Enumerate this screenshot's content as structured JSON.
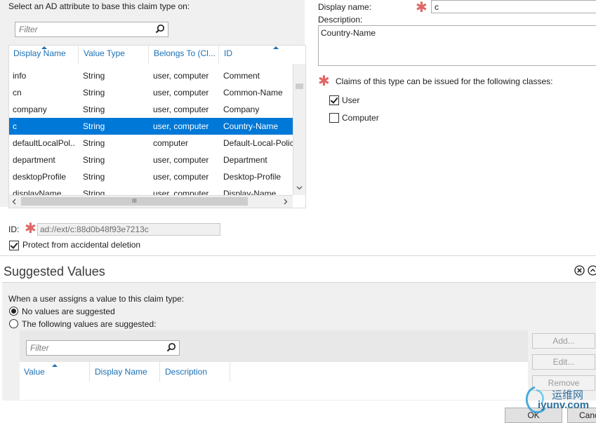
{
  "attribute_section": {
    "heading": "Select an AD attribute to base this claim type on:",
    "filter_placeholder": "Filter",
    "columns": [
      "Display Name",
      "Value Type",
      "Belongs To (Cl...",
      "ID"
    ],
    "rows": [
      {
        "display_name": "info",
        "value_type": "String",
        "belongs_to": "user, computer",
        "id": "Comment"
      },
      {
        "display_name": "cn",
        "value_type": "String",
        "belongs_to": "user, computer",
        "id": "Common-Name"
      },
      {
        "display_name": "company",
        "value_type": "String",
        "belongs_to": "user, computer",
        "id": "Company"
      },
      {
        "display_name": "c",
        "value_type": "String",
        "belongs_to": "user, computer",
        "id": "Country-Name",
        "selected": true
      },
      {
        "display_name": "defaultLocalPol...",
        "value_type": "String",
        "belongs_to": "computer",
        "id": "Default-Local-Polic"
      },
      {
        "display_name": "department",
        "value_type": "String",
        "belongs_to": "user, computer",
        "id": "Department"
      },
      {
        "display_name": "desktopProfile",
        "value_type": "String",
        "belongs_to": "user, computer",
        "id": "Desktop-Profile"
      },
      {
        "display_name": "displayName",
        "value_type": "String",
        "belongs_to": "user, computer",
        "id": "Display-Name"
      }
    ],
    "hscroll_glyph": "III",
    "id_label": "ID:",
    "id_value": "ad://ext/c:88d0b48f93e7213c",
    "protect_label": "Protect from accidental deletion",
    "protect_checked": true
  },
  "details": {
    "display_name_label": "Display name:",
    "display_name_value": "c",
    "description_label": "Description:",
    "description_value": "Country-Name",
    "classes_label": "Claims of this type can be issued for the following classes:",
    "classes": [
      {
        "label": "User",
        "checked": true
      },
      {
        "label": "Computer",
        "checked": false
      }
    ]
  },
  "suggested": {
    "title": "Suggested Values",
    "prompt": "When a user assigns a value to this claim type:",
    "options": [
      {
        "label": "No values are suggested",
        "selected": true
      },
      {
        "label": "The following values are suggested:",
        "selected": false
      }
    ],
    "filter_placeholder": "Filter",
    "columns": [
      "Value",
      "Display Name",
      "Description"
    ],
    "buttons": {
      "add": "Add...",
      "edit": "Edit...",
      "remove": "Remove"
    }
  },
  "footer": {
    "ok": "OK",
    "cancel": "Canc"
  },
  "watermark": {
    "text_cn": "运维网",
    "text_en": "iyunv.com"
  },
  "colors": {
    "accent": "#1a6fb5",
    "selection": "#0078d7",
    "required": "#e06666"
  }
}
